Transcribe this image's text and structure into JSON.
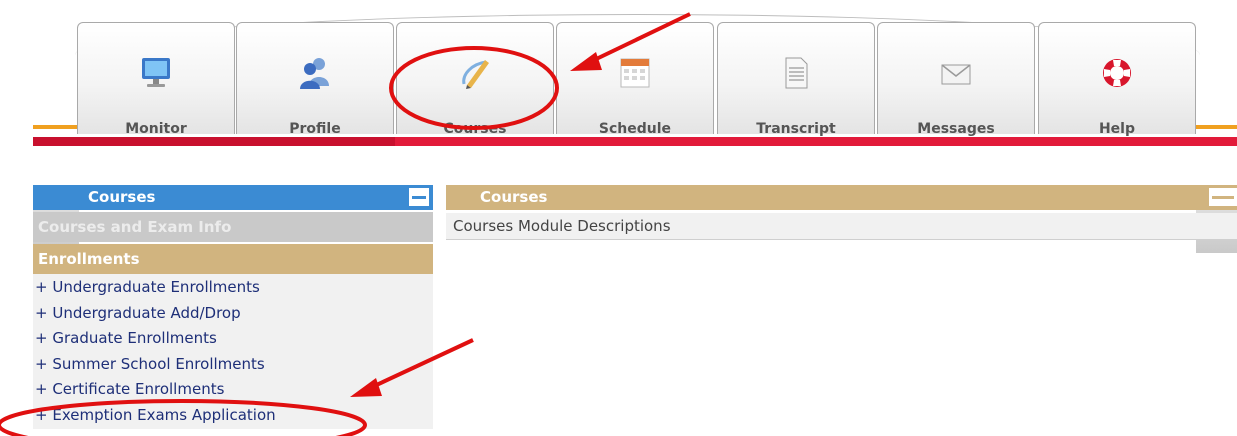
{
  "nav": {
    "tabs": [
      {
        "label": "Monitor"
      },
      {
        "label": "Profile"
      },
      {
        "label": "Courses"
      },
      {
        "label": "Schedule"
      },
      {
        "label": "Transcript"
      },
      {
        "label": "Messages"
      },
      {
        "label": "Help"
      }
    ]
  },
  "sidebar": {
    "title": "Courses",
    "section_info": "Courses and Exam Info",
    "section_enrollments": "Enrollments",
    "links": [
      "+ Undergraduate Enrollments",
      "+ Undergraduate Add/Drop",
      "+ Graduate Enrollments",
      "+ Summer School Enrollments",
      "+ Certificate Enrollments",
      "+ Exemption Exams Application"
    ]
  },
  "main": {
    "title": "Courses",
    "row": "Courses Module Descriptions"
  },
  "colors": {
    "accent_blue": "#3b8bd3",
    "accent_tan": "#d1b47f",
    "accent_red": "#e21a3a",
    "annotation_red": "#e01010"
  }
}
